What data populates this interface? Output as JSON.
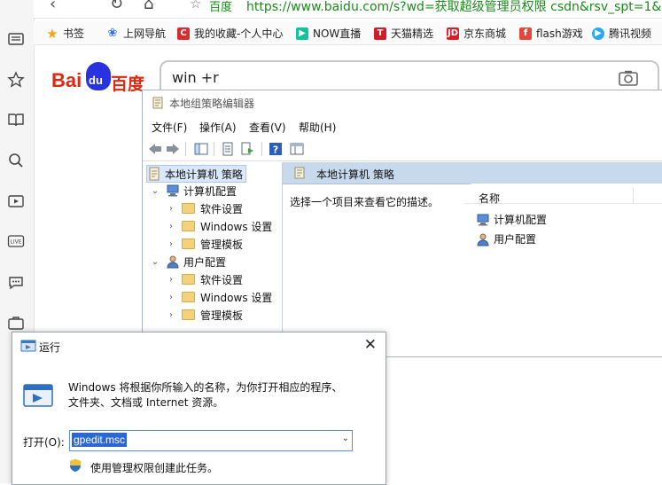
{
  "browser": {
    "address_label": "百度",
    "url": "https://www.baidu.com/s?wd=获取超级管理员权限 csdn&rsv_spt=1&r",
    "bookmarks": [
      {
        "label": "书签",
        "icon": "star-icon",
        "color": "#f1a31b"
      },
      {
        "label": "上网导航",
        "icon": "paw-icon",
        "color": "#3071e8"
      },
      {
        "label": "我的收藏-个人中心",
        "icon": "collection-icon",
        "color": "#d62e2e"
      },
      {
        "label": "NOW直播",
        "icon": "now-icon",
        "color": "#14c39a"
      },
      {
        "label": "天猫精选",
        "icon": "tmall-icon",
        "color": "#d11c2b"
      },
      {
        "label": "京东商城",
        "icon": "jd-icon",
        "color": "#d4202a"
      },
      {
        "label": "flash游戏",
        "icon": "flash-icon",
        "color": "#e2473c"
      },
      {
        "label": "腾讯视频",
        "icon": "tencent-video-icon",
        "color": "#2aa8f2"
      }
    ]
  },
  "baidu": {
    "logo_text_left": "Bai",
    "logo_paw_text": "du",
    "logo_text_right": "百度",
    "search_value": "win +r"
  },
  "gpedit": {
    "title": "本地组策略编辑器",
    "menu": [
      "文件(F)",
      "操作(A)",
      "查看(V)",
      "帮助(H)"
    ],
    "tree": {
      "root": "本地计算机 策略",
      "computer_config": "计算机配置",
      "user_config": "用户配置",
      "children": [
        "软件设置",
        "Windows 设置",
        "管理模板"
      ]
    },
    "right_header": "本地计算机 策略",
    "description": "选择一个项目来查看它的描述。",
    "column_name": "名称",
    "items": [
      "计算机配置",
      "用户配置"
    ]
  },
  "run": {
    "title": "运行",
    "message_line1": "Windows 将根据你所输入的名称，为你打开相应的程序、",
    "message_line2": "文件夹、文档或 Internet 资源。",
    "open_label": "打开(O):",
    "open_value": "gpedit.msc",
    "admin_text": "使用管理权限创建此任务。",
    "close_glyph": "✕"
  },
  "colors": {
    "baidu_red": "#de2910",
    "baidu_blue": "#2932e1",
    "url_green": "#1a8a1a",
    "selection_blue": "#2a66d4"
  }
}
